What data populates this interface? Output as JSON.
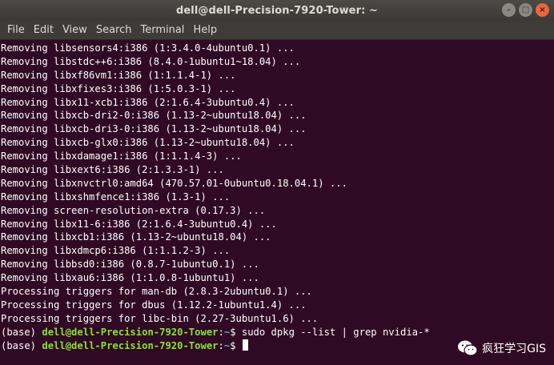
{
  "window": {
    "title": "dell@dell-Precision-7920-Tower: ~",
    "controls": {
      "minimize": "–",
      "maximize": "□",
      "close": "×"
    }
  },
  "menu": [
    "File",
    "Edit",
    "View",
    "Search",
    "Terminal",
    "Help"
  ],
  "terminal": {
    "output_lines": [
      "Removing libsensors4:i386 (1:3.4.0-4ubuntu0.1) ...",
      "Removing libstdc++6:i386 (8.4.0-1ubuntu1~18.04) ...",
      "Removing libxf86vm1:i386 (1:1.1.4-1) ...",
      "Removing libxfixes3:i386 (1:5.0.3-1) ...",
      "Removing libx11-xcb1:i386 (2:1.6.4-3ubuntu0.4) ...",
      "Removing libxcb-dri2-0:i386 (1.13-2~ubuntu18.04) ...",
      "Removing libxcb-dri3-0:i386 (1.13-2~ubuntu18.04) ...",
      "Removing libxcb-glx0:i386 (1.13-2~ubuntu18.04) ...",
      "Removing libxdamage1:i386 (1:1.1.4-3) ...",
      "Removing libxext6:i386 (2:1.3.3-1) ...",
      "Removing libxnvctrl0:amd64 (470.57.01-0ubuntu0.18.04.1) ...",
      "Removing libxshmfence1:i386 (1.3-1) ...",
      "Removing screen-resolution-extra (0.17.3) ...",
      "Removing libx11-6:i386 (2:1.6.4-3ubuntu0.4) ...",
      "Removing libxcb1:i386 (1.13-2~ubuntu18.04) ...",
      "Removing libxdmcp6:i386 (1:1.1.2-3) ...",
      "Removing libbsd0:i386 (0.8.7-1ubuntu0.1) ...",
      "Removing libxau6:i386 (1:1.0.8-1ubuntu1) ...",
      "Processing triggers for man-db (2.8.3-2ubuntu0.1) ...",
      "Processing triggers for dbus (1.12.2-1ubuntu1.4) ...",
      "Processing triggers for libc-bin (2.27-3ubuntu1.6) ..."
    ],
    "prompts": [
      {
        "env": "(base) ",
        "user_host": "dell@dell-Precision-7920-Tower",
        "sep": ":",
        "path": "~",
        "symbol": "$ ",
        "command": "sudo dpkg --list | grep nvidia-*"
      },
      {
        "env": "(base) ",
        "user_host": "dell@dell-Precision-7920-Tower",
        "sep": ":",
        "path": "~",
        "symbol": "$ ",
        "command": ""
      }
    ]
  },
  "watermark": {
    "text": "疯狂学习GIS",
    "icon": "wechat-icon"
  },
  "colors": {
    "terminal_bg": "#300a24",
    "user_host": "#8ae234",
    "path": "#729fcf",
    "close_button": "#e9663e"
  }
}
